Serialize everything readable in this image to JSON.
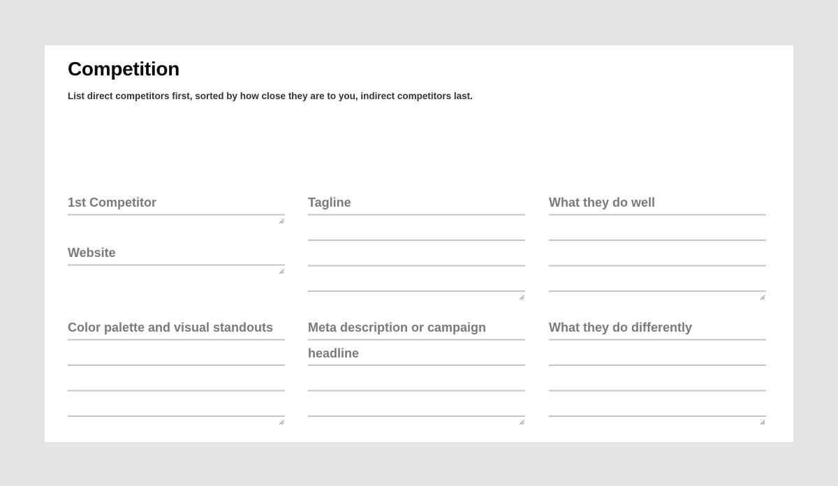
{
  "section": {
    "title": "Competition",
    "description": "List direct competitors first, sorted by how close they are to you, indirect competitors last."
  },
  "fields": {
    "competitor": {
      "placeholder": "1st Competitor",
      "value": ""
    },
    "website": {
      "placeholder": "Website",
      "value": ""
    },
    "tagline": {
      "placeholder": "Tagline",
      "value": ""
    },
    "does_well": {
      "placeholder": "What they do well",
      "value": ""
    },
    "color_palette": {
      "placeholder": "Color palette and visual standouts",
      "value": ""
    },
    "meta_description": {
      "placeholder": "Meta description or campaign headline",
      "value": ""
    },
    "does_differently": {
      "placeholder": "What they do differently",
      "value": ""
    }
  },
  "icons": {
    "resize_handle": "resize-grip-icon"
  }
}
